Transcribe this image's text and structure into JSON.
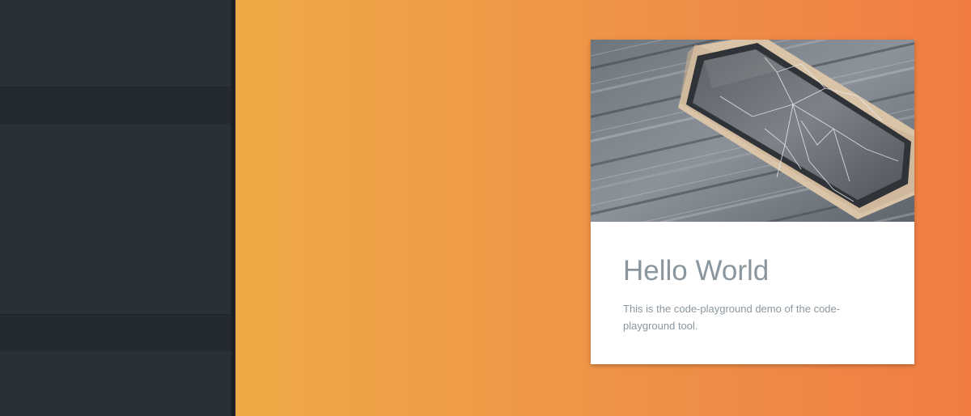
{
  "card": {
    "title": "Hello World",
    "description": "This is the code-playground demo of the code-playground tool.",
    "image_subject": "cracked-smartphone-on-wooden-table"
  },
  "colors": {
    "sidebar": "#2a3038",
    "sidebar_strip": "#242a31",
    "gradient_start": "#eeaa46",
    "gradient_end": "#f07c44",
    "card_text": "#8a969e"
  }
}
